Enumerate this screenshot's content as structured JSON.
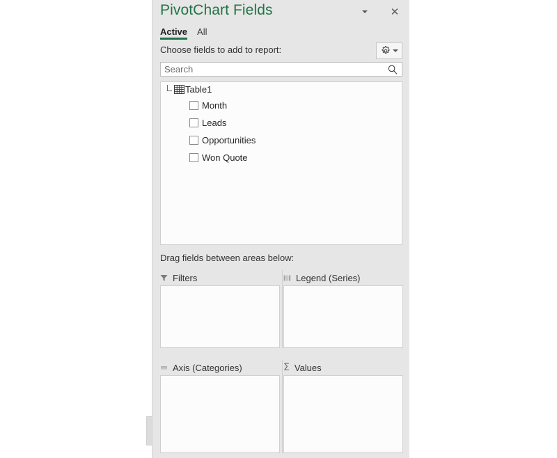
{
  "pane": {
    "title": "PivotChart Fields",
    "menu_icon": "chevron-down-icon",
    "close_icon": "close-icon",
    "accent_color": "#217346",
    "background_color": "#e6e6e6"
  },
  "tabs": [
    {
      "label": "Active",
      "selected": true
    },
    {
      "label": "All",
      "selected": false
    }
  ],
  "choose": {
    "label": "Choose fields to add to report:",
    "gear_icon": "gear-icon",
    "gear_dropdown_icon": "chevron-down-icon"
  },
  "search": {
    "value": "",
    "placeholder": "Search",
    "icon": "search-icon"
  },
  "field_list": {
    "table": {
      "label": "Table1",
      "icon": "table-icon",
      "expander_icon": "tree-elbow-icon",
      "expanded": true
    },
    "fields": [
      {
        "label": "Month",
        "checked": false
      },
      {
        "label": "Leads",
        "checked": false
      },
      {
        "label": "Opportunities",
        "checked": false
      },
      {
        "label": "Won Quote",
        "checked": false
      }
    ]
  },
  "areas": {
    "hint": "Drag fields between areas below:",
    "zones": [
      {
        "label": "Filters",
        "icon": "filter-funnel-icon",
        "items": []
      },
      {
        "label": "Legend (Series)",
        "icon": "vertical-bars-icon",
        "items": []
      },
      {
        "label": "Axis (Categories)",
        "icon": "horizontal-bars-icon",
        "items": []
      },
      {
        "label": "Values",
        "icon": "sigma-icon",
        "items": []
      }
    ]
  }
}
